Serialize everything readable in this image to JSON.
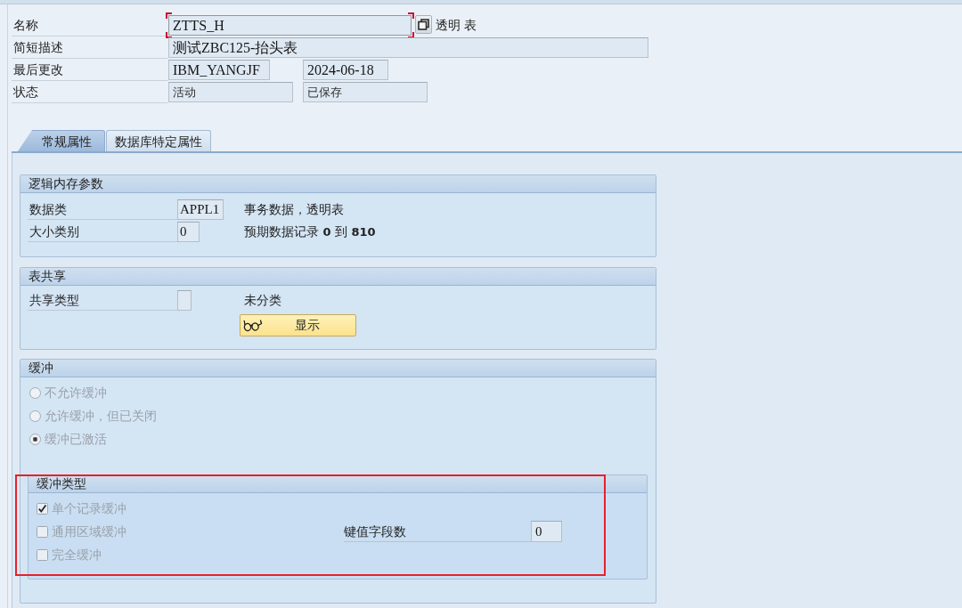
{
  "header": {
    "rows": [
      {
        "label": "名称",
        "fields": [
          {
            "value": "ZTTS_H",
            "focused": true
          }
        ],
        "note": "透明 表"
      },
      {
        "label": "简短描述",
        "fields": [
          {
            "value": "测试ZBC125-抬头表",
            "focused": false
          }
        ]
      },
      {
        "label": "最后更改",
        "fields": [
          {
            "value": "IBM_YANGJF",
            "focused": false
          },
          {
            "value": "2024-06-18",
            "focused": false
          }
        ]
      },
      {
        "label": "状态",
        "fields": [
          {
            "value": "活动",
            "focused": false
          },
          {
            "value": "已保存",
            "focused": false
          }
        ]
      }
    ]
  },
  "tabs": [
    {
      "label": "常规属性",
      "selected": true
    },
    {
      "label": "数据库特定属性",
      "selected": false
    }
  ],
  "logical_storage": {
    "title": "逻辑内存参数",
    "rows": [
      {
        "label": "数据类",
        "value": "APPL1",
        "description": "事务数据，透明表"
      },
      {
        "label": "大小类别",
        "value": "0",
        "description": "预期数据记录 **0** 到 **810**"
      }
    ]
  },
  "table_sharing": {
    "title": "表共享",
    "rows": [
      {
        "label": "共享类型",
        "description": "未分类"
      }
    ],
    "button": {
      "label": "显示"
    }
  },
  "buffering": {
    "title": "缓冲",
    "options": [
      {
        "label": "不允许缓冲",
        "selected": false,
        "disabled": true
      },
      {
        "label": "允许缓冲，但已关闭",
        "selected": false,
        "disabled": true
      },
      {
        "label": "缓冲已激活",
        "selected": true,
        "disabled": true
      }
    ],
    "buffering_type": {
      "title": "缓冲类型",
      "checkboxes": [
        {
          "label": "单个记录缓冲",
          "checked": true,
          "disabled": true
        },
        {
          "label": "通用区域缓冲",
          "checked": false,
          "disabled": true
        },
        {
          "label": "完全缓冲",
          "checked": false,
          "disabled": true
        }
      ],
      "key_fields": {
        "label": "键值字段数",
        "value": "0"
      }
    }
  },
  "overlays": [
    {
      "kind": "rectangle"
    }
  ]
}
